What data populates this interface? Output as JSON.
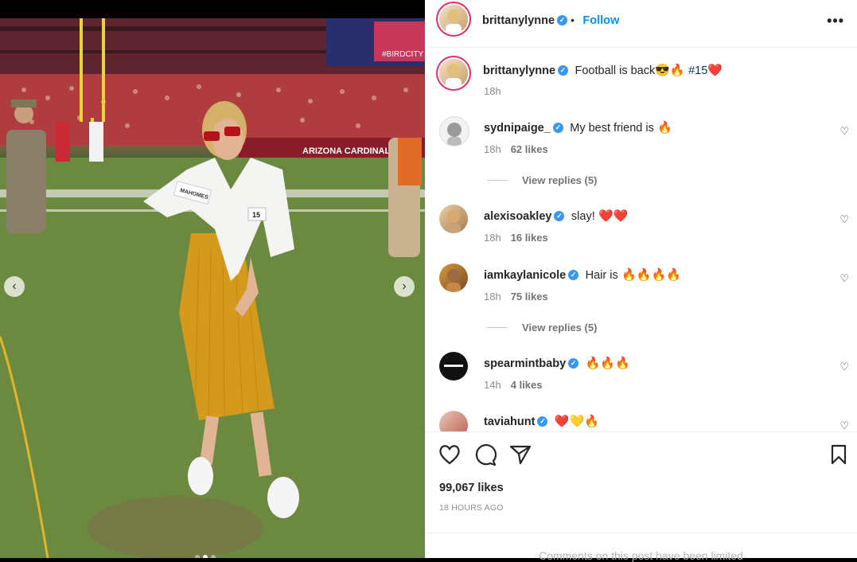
{
  "header": {
    "username": "brittanylynne",
    "separator": "•",
    "follow_label": "Follow",
    "more_icon": "more-horizontal-icon"
  },
  "caption": {
    "username": "brittanylynne",
    "text": "Football is back",
    "emojis": "😎🔥",
    "hashtag": "#15",
    "trailing_emoji": "❤️",
    "time": "18h"
  },
  "comments": [
    {
      "username": "sydnipaige_",
      "verified": true,
      "text": "My best friend is",
      "emojis": "🔥",
      "time": "18h",
      "likes": "62 likes",
      "replies": "View replies (5)"
    },
    {
      "username": "alexisoakley",
      "verified": true,
      "text": "slay!",
      "emojis": "❤️❤️",
      "time": "18h",
      "likes": "16 likes"
    },
    {
      "username": "iamkaylanicole",
      "verified": true,
      "text": "Hair is",
      "emojis": "🔥🔥🔥🔥",
      "time": "18h",
      "likes": "75 likes",
      "replies": "View replies (5)"
    },
    {
      "username": "spearmintbaby",
      "verified": true,
      "text": "",
      "emojis": "🔥🔥🔥",
      "time": "14h",
      "likes": "4 likes"
    },
    {
      "username": "taviahunt",
      "verified": true,
      "text": "",
      "emojis": "❤️💛🔥"
    }
  ],
  "actions": {
    "like_icon": "heart-icon",
    "comment_icon": "comment-icon",
    "share_icon": "share-icon",
    "save_icon": "bookmark-icon"
  },
  "likes_count": "99,067 likes",
  "posted_ago": "18 HOURS AGO",
  "comments_notice": "Comments on this post have been limited",
  "photo": {
    "stadium_text": "ARIZONA CARDINALS",
    "jersey_number": "15",
    "jacket_label": "MAHOMES",
    "scoreboard_text": "#BIRDCITY",
    "carousel_current": 2,
    "carousel_total": 3
  },
  "colors": {
    "verified": "#3897f0",
    "follow": "#0095f6",
    "dress": "#d59a1c",
    "story_ring": "#e1306c"
  }
}
